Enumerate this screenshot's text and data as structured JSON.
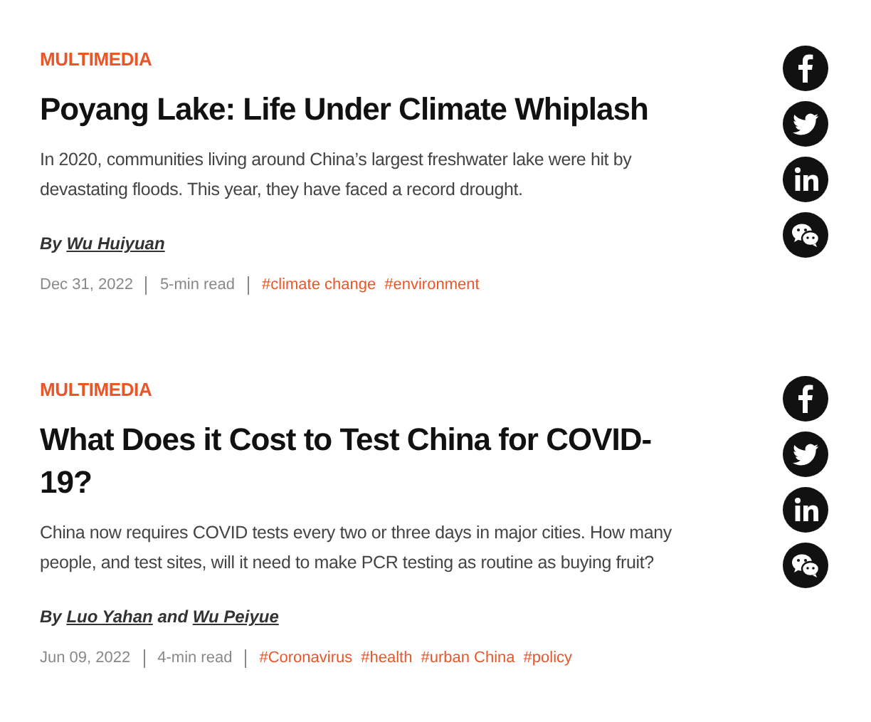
{
  "articles": [
    {
      "category": "MULTIMEDIA",
      "title": "Poyang Lake: Life Under Climate Whiplash",
      "summary": "In 2020, communities living around China’s largest freshwater lake were hit by devastating floods. This year, they have faced a record drought.",
      "byline": [
        {
          "kind": "text",
          "text": "By"
        },
        {
          "kind": "link",
          "text": "Wu Huiyuan"
        }
      ],
      "date": "Dec 31, 2022",
      "read_time": "5-min read",
      "tags": [
        "#climate change",
        "#environment"
      ],
      "share": [
        {
          "kind": "facebook"
        },
        {
          "kind": "twitter"
        },
        {
          "kind": "linkedin"
        },
        {
          "kind": "wechat"
        }
      ]
    },
    {
      "category": "MULTIMEDIA",
      "title": "What Does it Cost to Test China for COVID-19?",
      "summary": "China now requires COVID tests every two or three days in major cities. How many people, and test sites, will it need to make PCR testing as routine as buying fruit?",
      "byline": [
        {
          "kind": "text",
          "text": "By"
        },
        {
          "kind": "link",
          "text": "Luo Yahan"
        },
        {
          "kind": "text",
          "text": "and"
        },
        {
          "kind": "link",
          "text": "Wu Peiyue"
        }
      ],
      "date": "Jun 09, 2022",
      "read_time": "4-min read",
      "tags": [
        "#Coronavirus",
        "#health",
        "#urban China",
        "#policy"
      ],
      "share": [
        {
          "kind": "facebook"
        },
        {
          "kind": "twitter"
        },
        {
          "kind": "linkedin"
        },
        {
          "kind": "wechat"
        }
      ]
    }
  ]
}
